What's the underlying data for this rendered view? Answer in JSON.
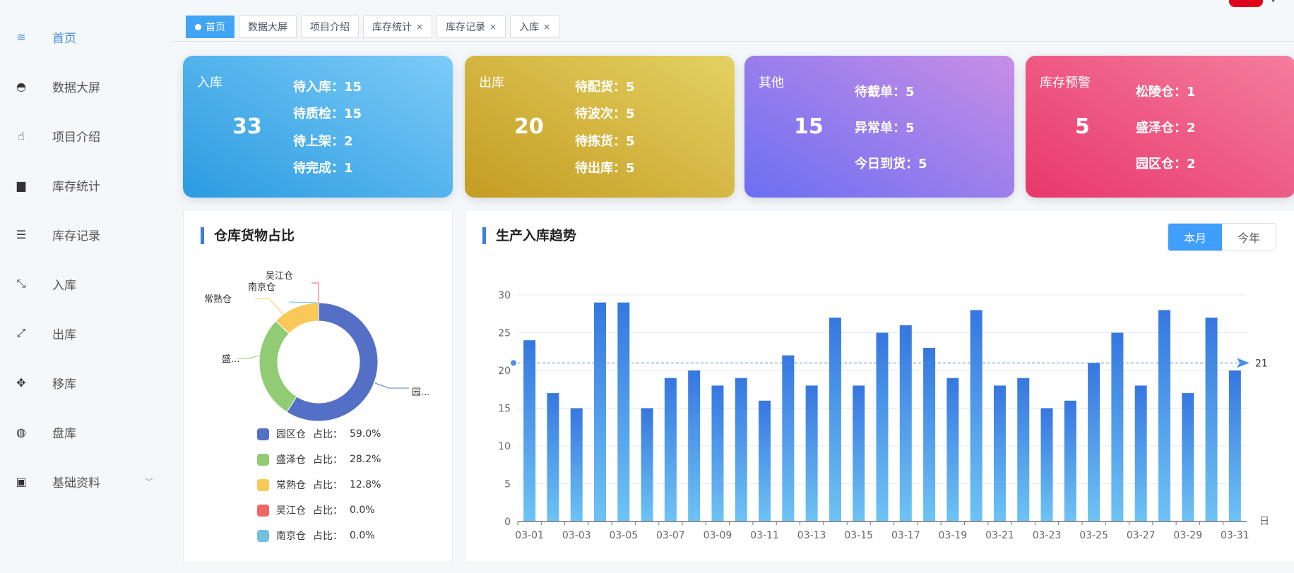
{
  "sidebar": {
    "items": [
      {
        "label": "首页",
        "icon": "layers-icon",
        "active": true
      },
      {
        "label": "数据大屏",
        "icon": "dashboard-icon"
      },
      {
        "label": "项目介绍",
        "icon": "hand-pointer-icon"
      },
      {
        "label": "库存统计",
        "icon": "bar-chart-icon"
      },
      {
        "label": "库存记录",
        "icon": "list-icon"
      },
      {
        "label": "入库",
        "icon": "compress-icon"
      },
      {
        "label": "出库",
        "icon": "expand-icon"
      },
      {
        "label": "移库",
        "icon": "move-icon"
      },
      {
        "label": "盘库",
        "icon": "lifebuoy-icon"
      },
      {
        "label": "基础资料",
        "icon": "excel-icon",
        "expandable": true
      }
    ]
  },
  "tabs": [
    {
      "label": "首页",
      "active": true
    },
    {
      "label": "数据大屏"
    },
    {
      "label": "项目介绍"
    },
    {
      "label": "库存统计",
      "closable": true
    },
    {
      "label": "库存记录",
      "closable": true
    },
    {
      "label": "入库",
      "closable": true
    }
  ],
  "close_glyph": "×",
  "cards": [
    {
      "title": "入库",
      "total": "33",
      "rows": [
        "待入库：",
        "15",
        "待质检：",
        "15",
        "待上架：",
        "2",
        "待完成：",
        "1"
      ]
    },
    {
      "title": "出库",
      "total": "20",
      "rows": [
        "待配货：",
        "5",
        "待波次：",
        "5",
        "待拣货：",
        "5",
        "待出库：",
        "5"
      ]
    },
    {
      "title": "其他",
      "total": "15",
      "rows": [
        "待截单：",
        "5",
        "异常单：",
        "5",
        "今日到货：",
        "5"
      ]
    },
    {
      "title": "库存预警",
      "total": "5",
      "rows": [
        "松陵仓：",
        "1",
        "盛泽仓：",
        "2",
        "园区仓：",
        "2"
      ]
    }
  ],
  "colors": {
    "accent": "#409eff",
    "card1": [
      "#2b9be0",
      "#7ccbf8"
    ],
    "card2": [
      "#c49c22",
      "#e4d163"
    ],
    "card3": [
      "#6c6ff2",
      "#c88ee6"
    ],
    "card4": [
      "#e8386a",
      "#f47d9e"
    ]
  },
  "pie_panel": {
    "title": "仓库货物占比",
    "ratio_label": "占比：",
    "chart_data": {
      "type": "pie",
      "donut": true,
      "slices": [
        {
          "name": "园区仓",
          "short": "园...",
          "value": 59.0,
          "label": "59.0%",
          "color": "#5470c6"
        },
        {
          "name": "盛泽仓",
          "short": "盛...",
          "value": 28.2,
          "label": "28.2%",
          "color": "#91cc75"
        },
        {
          "name": "常熟仓",
          "short": "常熟仓",
          "value": 12.8,
          "label": "12.8%",
          "color": "#fac858"
        },
        {
          "name": "吴江仓",
          "short": "吴江仓",
          "value": 0.0,
          "label": "0.0%",
          "color": "#ee6666"
        },
        {
          "name": "南京仓",
          "short": "南京仓",
          "value": 0.0,
          "label": "0.0%",
          "color": "#73c0de"
        }
      ],
      "legend": "bottom"
    }
  },
  "bar_panel": {
    "title": "生产入库趋势",
    "toggle": [
      "本月",
      "今年"
    ],
    "toggle_active": 0,
    "chart_data": {
      "type": "bar",
      "categories": [
        "03-01",
        "03-02",
        "03-03",
        "03-04",
        "03-05",
        "03-06",
        "03-07",
        "03-08",
        "03-09",
        "03-10",
        "03-11",
        "03-12",
        "03-13",
        "03-14",
        "03-15",
        "03-16",
        "03-17",
        "03-18",
        "03-19",
        "03-20",
        "03-21",
        "03-22",
        "03-23",
        "03-24",
        "03-25",
        "03-26",
        "03-27",
        "03-28",
        "03-29",
        "03-30",
        "03-31"
      ],
      "values": [
        24,
        17,
        15,
        29,
        29,
        15,
        19,
        20,
        18,
        19,
        16,
        22,
        18,
        27,
        18,
        25,
        26,
        23,
        19,
        28,
        18,
        19,
        15,
        16,
        21,
        25,
        18,
        28,
        17,
        27,
        20
      ],
      "ylim": [
        0,
        30
      ],
      "yticks": [
        "0",
        "5",
        "10",
        "15",
        "20",
        "25",
        "30"
      ],
      "xlabel": "日",
      "grid": true,
      "mark_line": {
        "value": 21,
        "label": "21"
      },
      "bar_colors": [
        "#3677e0",
        "#6ec3f4"
      ]
    }
  }
}
